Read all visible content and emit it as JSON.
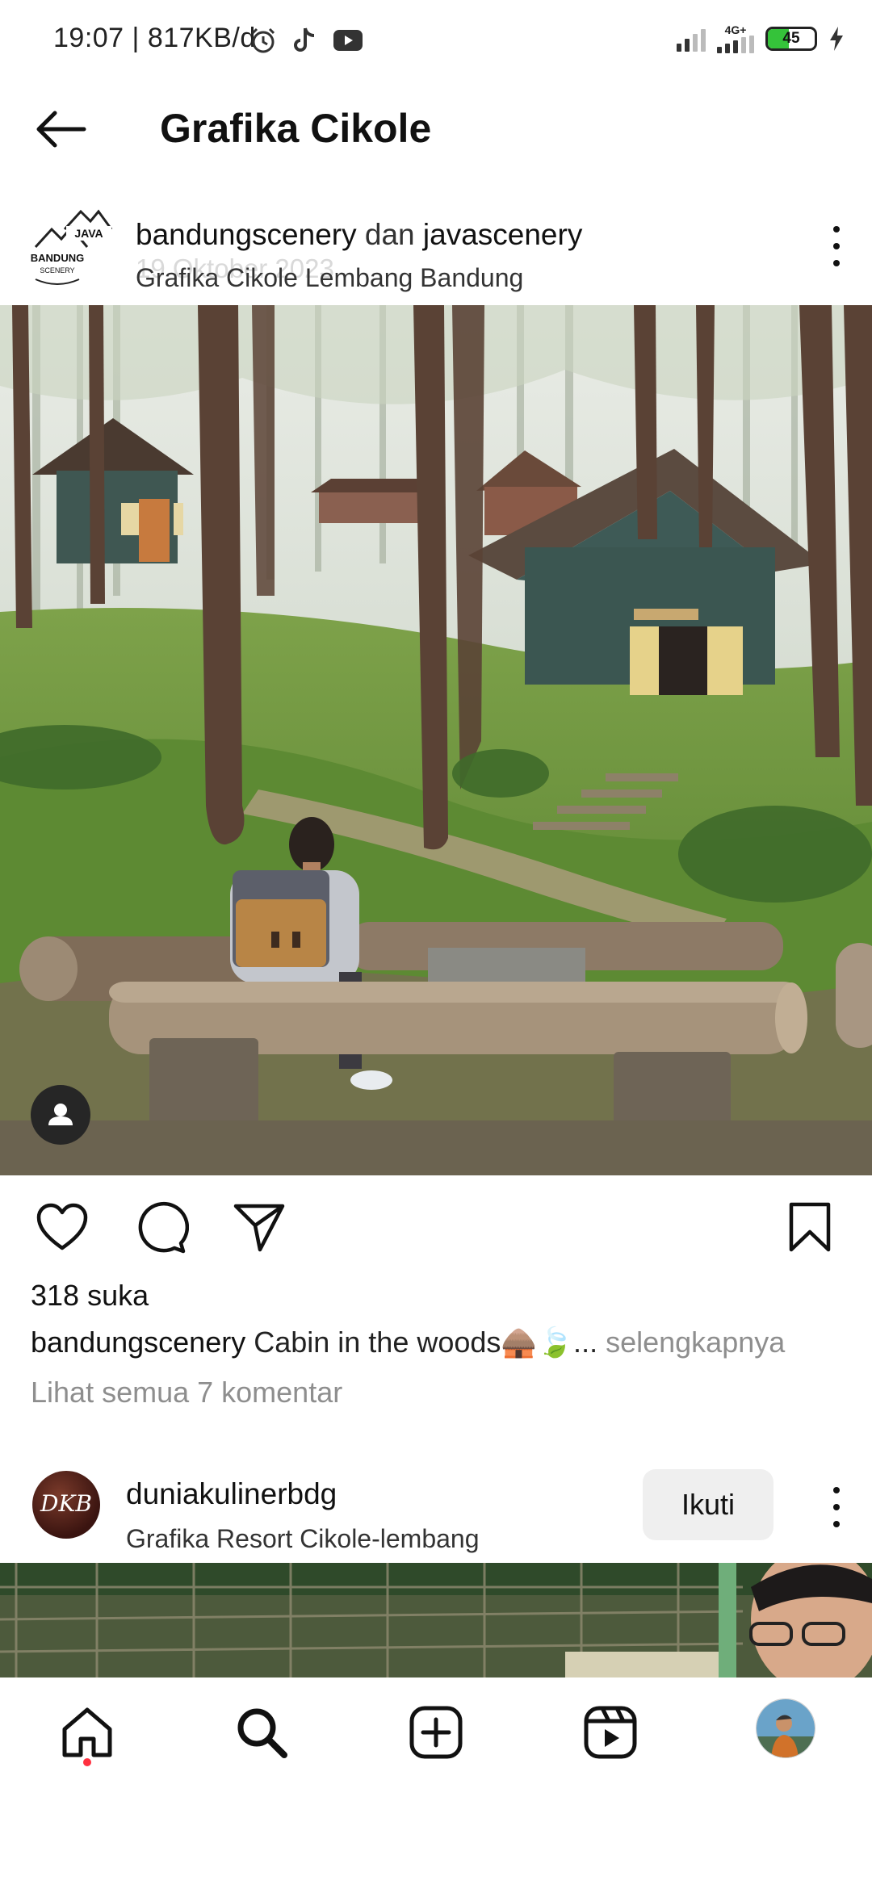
{
  "status_bar": {
    "time": "19:07",
    "net_speed": "817KB/d",
    "network_type": "4G+",
    "battery_level": "45",
    "icons": [
      "alarm-icon",
      "tiktok-icon",
      "youtube-icon",
      "signal-icon",
      "battery-icon",
      "charging-icon"
    ]
  },
  "header": {
    "title": "Grafika Cikole",
    "back_icon": "arrow-left-icon"
  },
  "post1": {
    "user_primary": "bandungscenery",
    "conjunction": "dan",
    "user_secondary": "javascenery",
    "date_ghost": "19 Oktober 2023",
    "location": "Grafika Cikole Lembang Bandung",
    "likes": "318 suka",
    "caption_user": "bandungscenery",
    "caption_text": "Cabin in the woods🛖🍃...",
    "caption_more": "selengkapnya",
    "comments_link": "Lihat semua 7 komentar",
    "logo_texts": [
      "BANDUNG",
      "JAVA",
      "SCENERY"
    ]
  },
  "post2": {
    "user": "duniakulinerbdg",
    "location": "Grafika Resort Cikole-lembang",
    "follow_label": "Ikuti",
    "avatar_text": "DKB"
  },
  "bottom_nav": {
    "items": [
      "home-icon",
      "search-icon",
      "create-icon",
      "reels-icon",
      "profile-avatar"
    ]
  }
}
